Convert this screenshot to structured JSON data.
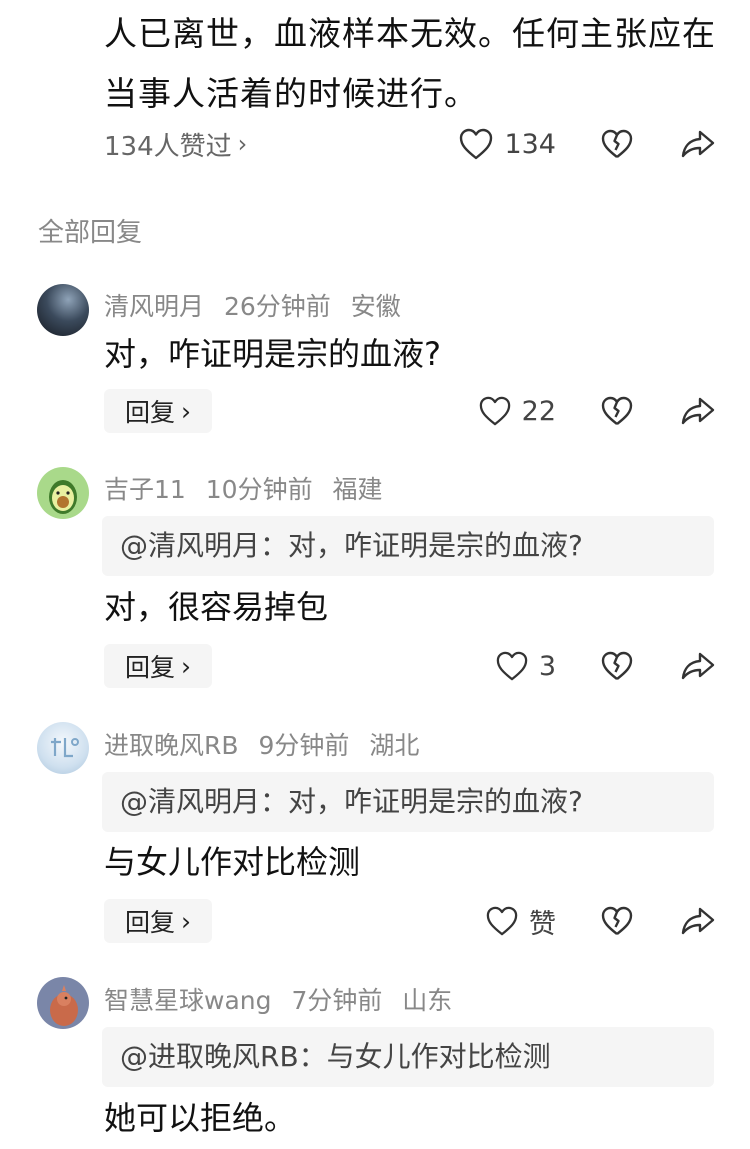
{
  "post": {
    "text": "人已离世，血液样本无效。任何主张应在当事人活着的时候进行。",
    "likes_summary": "134人赞过",
    "like_count": "134"
  },
  "section_title": "全部回复",
  "reply_label": "回复",
  "comments": [
    {
      "author": "清风明月",
      "time": "26分钟前",
      "location": "安徽",
      "quote": "",
      "text": "对，咋证明是宗的血液?",
      "like_count": "22"
    },
    {
      "author": "吉子11",
      "time": "10分钟前",
      "location": "福建",
      "quote": "@清风明月：对，咋证明是宗的血液?",
      "text": "对，很容易掉包",
      "like_count": "3"
    },
    {
      "author": "进取晚风RB",
      "time": "9分钟前",
      "location": "湖北",
      "quote": "@清风明月：对，咋证明是宗的血液?",
      "text": "与女儿作对比检测",
      "like_count": "赞"
    },
    {
      "author": "智慧星球wang",
      "time": "7分钟前",
      "location": "山东",
      "quote": "@进取晚风RB：与女儿作对比检测",
      "text": "她可以拒绝。",
      "like_count": ""
    }
  ],
  "icons": [
    "heart-icon",
    "heartbreak-icon",
    "share-icon",
    "chevron-right-icon"
  ]
}
